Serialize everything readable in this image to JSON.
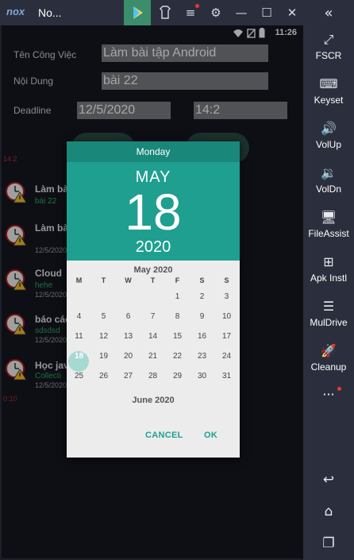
{
  "window": {
    "logo": "nox",
    "title": "No..."
  },
  "status": {
    "time": "11:26"
  },
  "form": {
    "name_label": "Tên Công Việc",
    "name_value": "Làm bài tập Android",
    "content_label": "Nội Dung",
    "content_value": "bài 22",
    "deadline_label": "Deadline",
    "date_value": "12/5/2020",
    "time_value": "14:2"
  },
  "tasks": [
    {
      "title": "Làm bà",
      "sub": "bài 22",
      "date": "",
      "time": ""
    },
    {
      "title": "Làm bà",
      "sub": "",
      "date": "12/5/2020",
      "time": "14:2"
    },
    {
      "title": "Cloud",
      "sub": "hehe",
      "date": "12/5/2020",
      "time": ""
    },
    {
      "title": "báo các",
      "sub": "sdsdsd",
      "date": "12/5/2020",
      "time": ""
    },
    {
      "title": "Học jav",
      "sub": "Collecti",
      "date": "12/5/2020",
      "time": "0:10"
    }
  ],
  "datepicker": {
    "day_of_week": "Monday",
    "month": "MAY",
    "day": "18",
    "year": "2020",
    "calendar_title": "May 2020",
    "next_title": "June 2020",
    "dow": [
      "M",
      "T",
      "W",
      "T",
      "F",
      "S",
      "S"
    ],
    "weeks": [
      [
        "",
        "",
        "",
        "",
        "1",
        "2",
        "3"
      ],
      [
        "4",
        "5",
        "6",
        "7",
        "8",
        "9",
        "10"
      ],
      [
        "11",
        "12",
        "13",
        "14",
        "15",
        "16",
        "17"
      ],
      [
        "18",
        "19",
        "20",
        "21",
        "22",
        "23",
        "24"
      ],
      [
        "25",
        "26",
        "27",
        "28",
        "29",
        "30",
        "31"
      ]
    ],
    "selected": "18",
    "cancel_label": "CANCEL",
    "ok_label": "OK"
  },
  "sidebar": {
    "collapse_icon": "«",
    "items": [
      {
        "icon": "fullscreen-icon",
        "glyph": "⤢",
        "label": "FSCR"
      },
      {
        "icon": "keyboard-icon",
        "glyph": "⌨",
        "label": "Keyset"
      },
      {
        "icon": "volume-up-icon",
        "glyph": "🔊",
        "label": "VolUp"
      },
      {
        "icon": "volume-down-icon",
        "glyph": "🔉",
        "label": "VolDn"
      },
      {
        "icon": "file-assist-icon",
        "glyph": "🖥",
        "label": "FileAssist"
      },
      {
        "icon": "apk-install-icon",
        "glyph": "⊞",
        "label": "Apk Instl"
      },
      {
        "icon": "multi-drive-icon",
        "glyph": "☰",
        "label": "MulDrive"
      },
      {
        "icon": "cleanup-icon",
        "glyph": "🚀",
        "label": "Cleanup"
      }
    ],
    "more_glyph": "···"
  },
  "colors": {
    "teal": "#1f9f8f",
    "teal_dark": "#19877a",
    "selected_day": "#a7d9d3"
  }
}
